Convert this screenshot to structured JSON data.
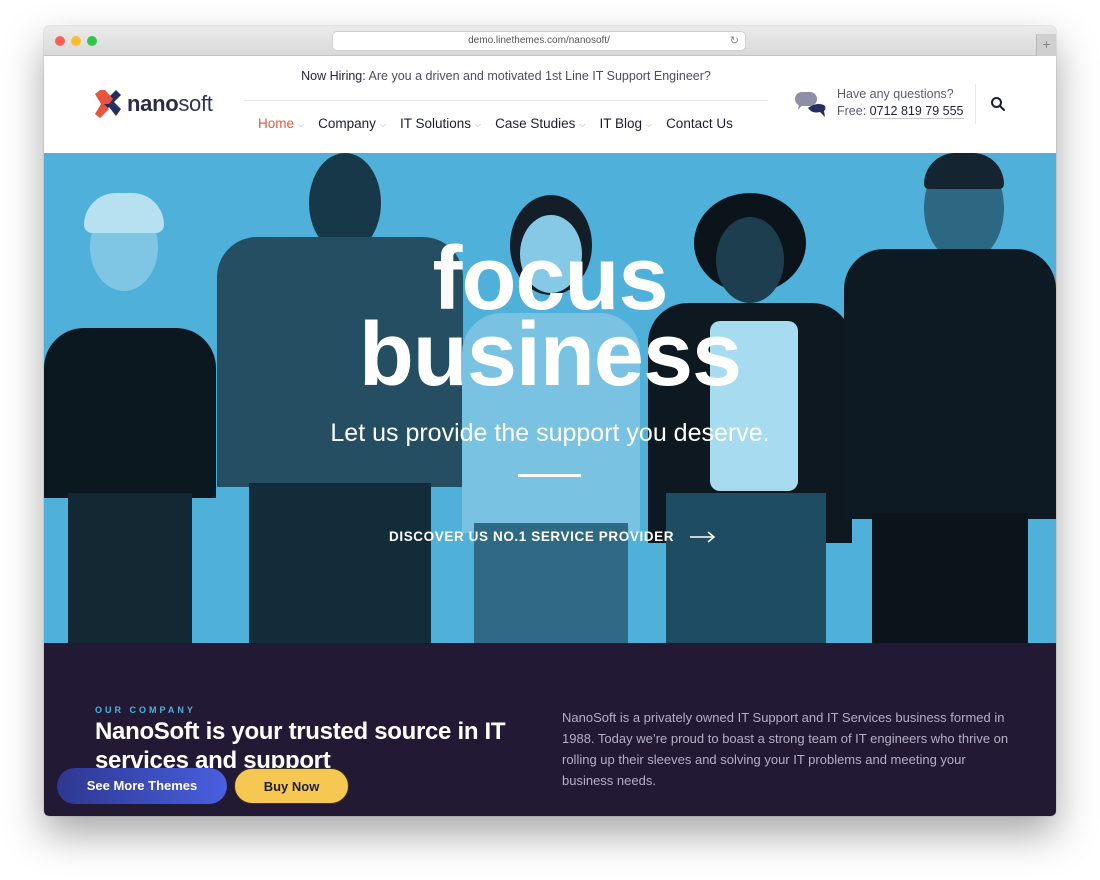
{
  "browser": {
    "url": "demo.linethemes.com/nanosoft/",
    "new_tab_label": "+"
  },
  "header": {
    "logo": {
      "bold": "nano",
      "light": "soft",
      "colors": {
        "red": "#e8553f",
        "navy": "#232d5e"
      }
    },
    "hiring": {
      "label": "Now Hiring:",
      "message": "Are you a driven and motivated 1st Line IT Support Engineer?"
    },
    "nav": [
      {
        "label": "Home",
        "active": true,
        "has_dropdown": true
      },
      {
        "label": "Company",
        "active": false,
        "has_dropdown": true
      },
      {
        "label": "IT Solutions",
        "active": false,
        "has_dropdown": true
      },
      {
        "label": "Case Studies",
        "active": false,
        "has_dropdown": true
      },
      {
        "label": "IT Blog",
        "active": false,
        "has_dropdown": true
      },
      {
        "label": "Contact Us",
        "active": false,
        "has_dropdown": false
      }
    ],
    "contact": {
      "question": "Have any questions?",
      "free_label": "Free:",
      "phone": "0712 819 79 555"
    },
    "dropdown_glyph": "⌄"
  },
  "hero": {
    "title_line1": "focus",
    "title_line2": "business",
    "subtitle": "Let us provide the support you deserve.",
    "cta": "DISCOVER US NO.1 SERVICE PROVIDER",
    "tint_color": "#4fb0da"
  },
  "company": {
    "eyebrow": "OUR COMPANY",
    "title": "NanoSoft is your trusted source in IT services and support",
    "description": "NanoSoft is a privately owned IT Support and IT Services business formed in 1988. Today we’re proud to boast a strong team of IT engineers who thrive on rolling up their sleeves and solving your IT problems and meeting your business needs.",
    "background": "#221a35"
  },
  "floating_buttons": {
    "see_more": "See More Themes",
    "buy_now": "Buy Now"
  }
}
